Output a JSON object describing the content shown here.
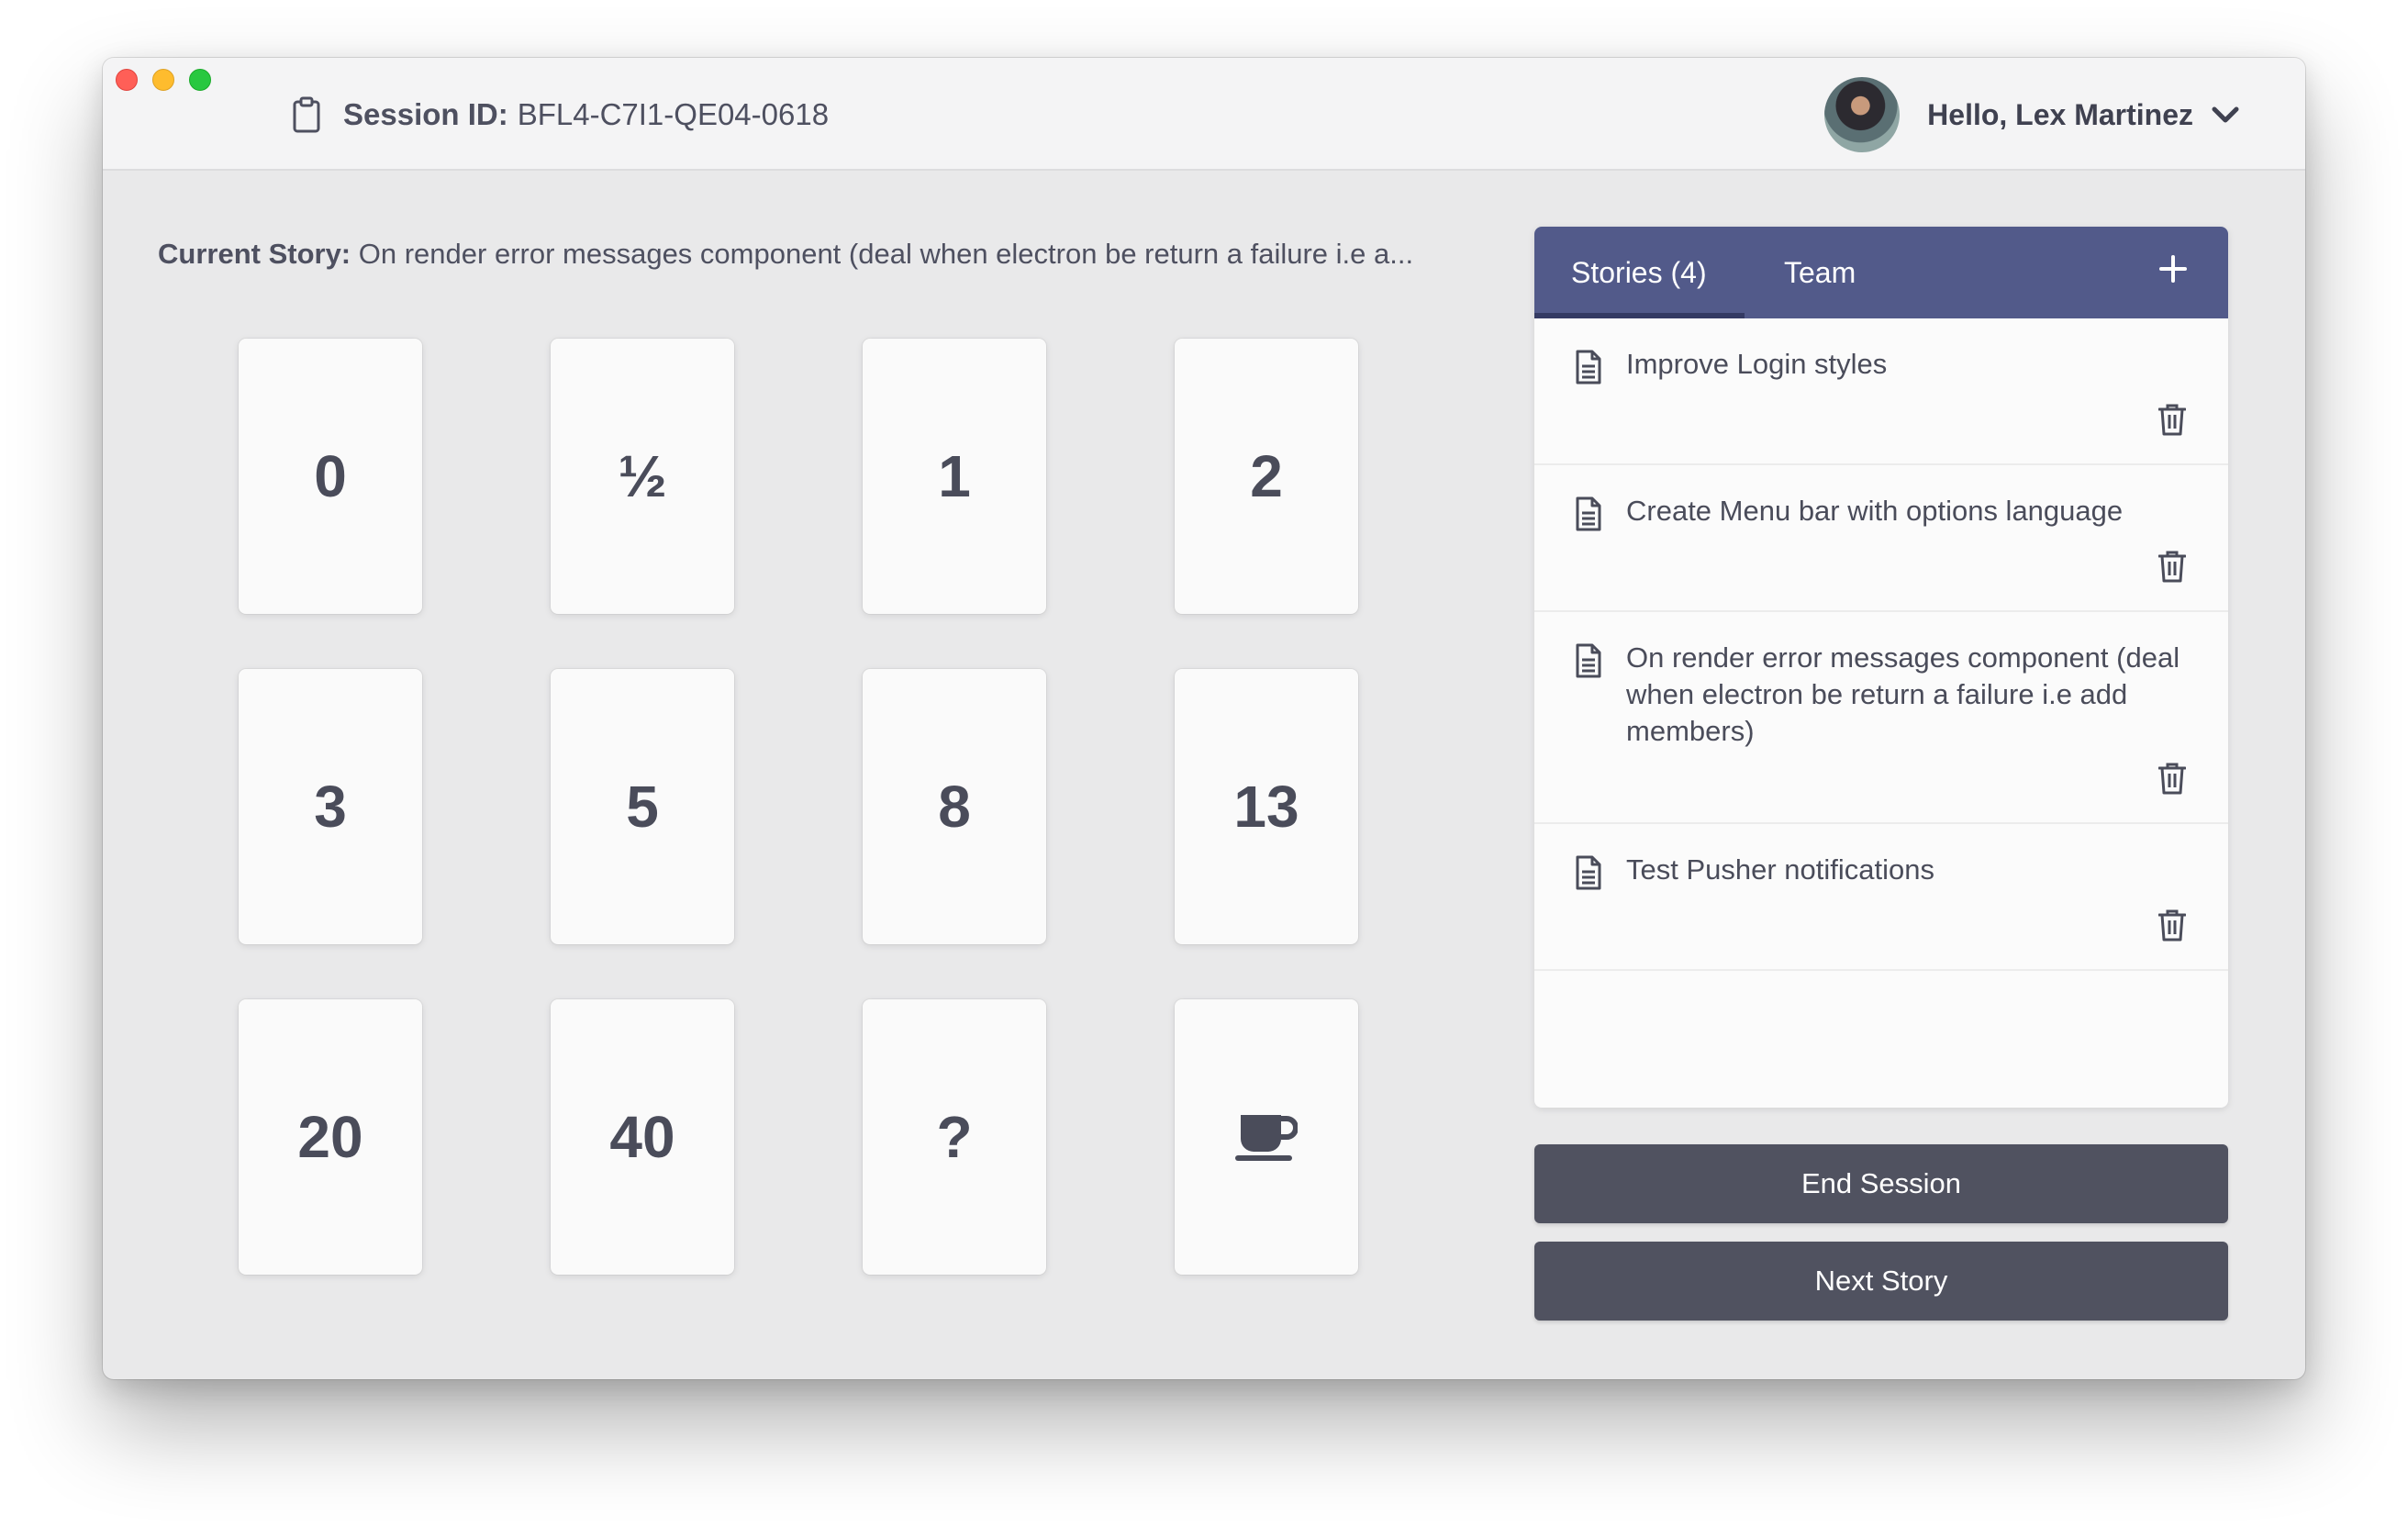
{
  "session": {
    "label": "Session ID:",
    "id": "BFL4-C7I1-QE04-0618"
  },
  "user": {
    "greeting": "Hello, Lex Martinez"
  },
  "current_story": {
    "label": "Current Story:",
    "text": "On render error messages component (deal when electron be return a failure i.e a..."
  },
  "cards": [
    {
      "value": "0"
    },
    {
      "value": "½"
    },
    {
      "value": "1"
    },
    {
      "value": "2"
    },
    {
      "value": "3"
    },
    {
      "value": "5"
    },
    {
      "value": "8"
    },
    {
      "value": "13"
    },
    {
      "value": "20"
    },
    {
      "value": "40"
    },
    {
      "value": "?"
    },
    {
      "icon": "coffee-icon"
    }
  ],
  "panel": {
    "tabs": [
      {
        "label": "Stories (4)",
        "active": true
      },
      {
        "label": "Team",
        "active": false
      }
    ],
    "add_icon": "plus-icon"
  },
  "stories": [
    {
      "title": "Improve Login styles"
    },
    {
      "title": "Create Menu bar with options language"
    },
    {
      "title": "On render error messages component (deal when electron be return a failure i.e add members)"
    },
    {
      "title": "Test Pusher notifications"
    }
  ],
  "buttons": {
    "end_session": "End Session",
    "next_story": "Next Story"
  },
  "colors": {
    "panel_header": "#525a8a",
    "button": "#505260",
    "text": "#4a4c5a"
  }
}
